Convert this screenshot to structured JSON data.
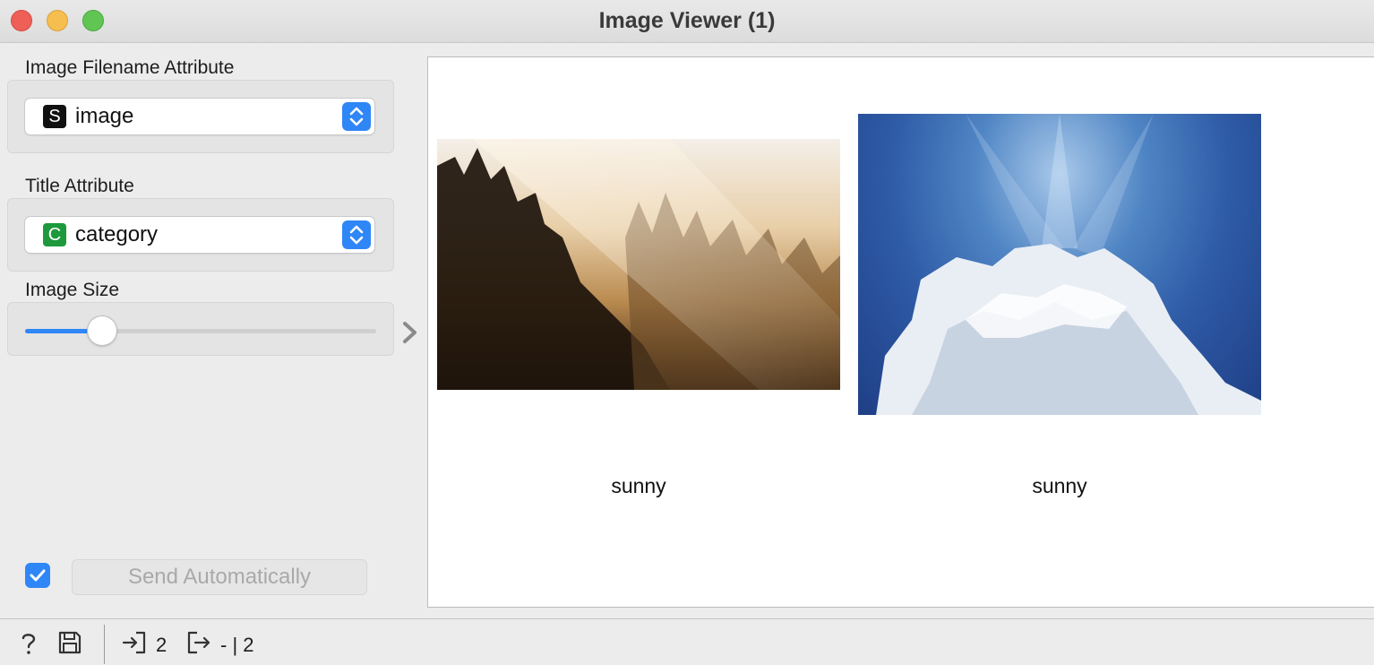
{
  "window": {
    "title": "Image Viewer (1)"
  },
  "controls": {
    "filename_attribute": {
      "label": "Image Filename Attribute",
      "type_badge": "S",
      "value": "image"
    },
    "title_attribute": {
      "label": "Title Attribute",
      "type_badge": "C",
      "value": "category"
    },
    "image_size": {
      "label": "Image Size",
      "level": 0.22
    },
    "auto_send": {
      "checked": true,
      "button_label": "Send Automatically"
    }
  },
  "images": [
    {
      "title": "sunny",
      "icon": "forest-sunrays-image"
    },
    {
      "title": "sunny",
      "icon": "sky-cloud-image"
    }
  ],
  "status": {
    "input_count": "2",
    "output_text": "- | 2"
  },
  "colors": {
    "accent": "#2f86f6",
    "continuous_badge": "#1e9a3c",
    "string_badge": "#111111"
  }
}
